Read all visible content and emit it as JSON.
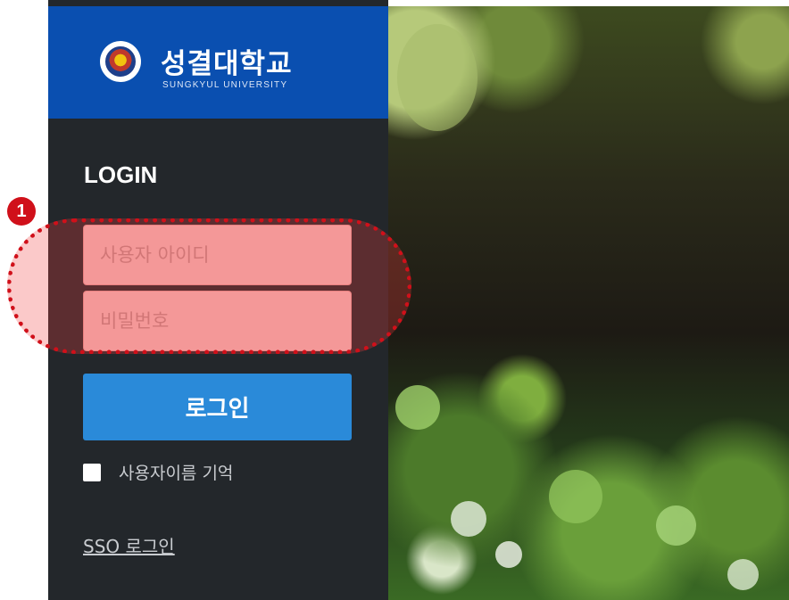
{
  "brand": {
    "name_ko": "성결대학교",
    "name_en": "SUNGKYUL UNIVERSITY",
    "seal_icon": "university-seal-icon",
    "color": "#0a4fb0"
  },
  "login": {
    "title": "LOGIN",
    "username_placeholder": "사용자 아이디",
    "password_placeholder": "비밀번호",
    "submit_label": "로그인",
    "remember_label": "사용자이름 기억",
    "sso_label": "SSO 로그인",
    "accent": "#2a8ad9"
  },
  "annotation": {
    "marker": "❶",
    "color": "#d0101a"
  }
}
